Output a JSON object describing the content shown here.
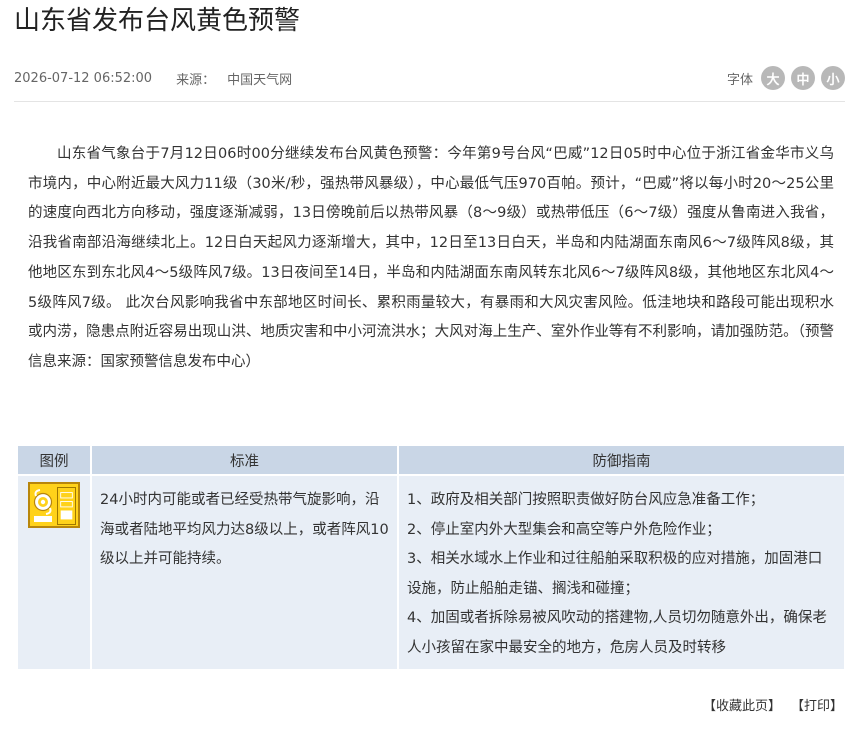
{
  "article": {
    "title": "山东省发布台风黄色预警",
    "date": "2026-07-12 06:52:00",
    "source_label": "来源：",
    "source": "中国天气网",
    "body": "山东省气象台于7月12日06时00分继续发布台风黄色预警：今年第9号台风“巴威”12日05时中心位于浙江省金华市义乌市境内，中心附近最大风力11级（30米/秒，强热带风暴级），中心最低气压970百帕。预计，“巴威”将以每小时20～25公里的速度向西北方向移动，强度逐渐减弱，13日傍晚前后以热带风暴（8～9级）或热带低压（6～7级）强度从鲁南进入我省，沿我省南部沿海继续北上。12日白天起风力逐渐增大，其中，12日至13日白天，半岛和内陆湖面东南风6～7级阵风8级，其他地区东到东北风4～5级阵风7级。13日夜间至14日，半岛和内陆湖面东南风转东北风6～7级阵风8级，其他地区东北风4～5级阵风7级。 此次台风影响我省中东部地区时间长、累积雨量较大，有暴雨和大风灾害风险。低洼地块和路段可能出现积水或内涝，隐患点附近容易出现山洪、地质灾害和中小河流洪水；大风对海上生产、室外作业等有不利影响，请加强防范。（预警信息来源：国家预警信息发布中心）"
  },
  "font_size": {
    "label": "字体",
    "large": "大",
    "medium": "中",
    "small": "小"
  },
  "table": {
    "headers": [
      "图例",
      "标准",
      "防御指南"
    ],
    "icon": "typhoon-yellow-warning-icon",
    "standard": "24小时内可能或者已经受热带气旋影响，沿海或者陆地平均风力达8级以上，或者阵风10级以上并可能持续。",
    "guides": [
      "1、政府及相关部门按照职责做好防台风应急准备工作；",
      "2、停止室内外大型集会和高空等户外危险作业；",
      "3、相关水域水上作业和过往船舶采取积极的应对措施，加固港口设施，防止船舶走锚、搁浅和碰撞；",
      "4、加固或者拆除易被风吹动的搭建物,人员切勿随意外出，确保老人小孩留在家中最安全的地方，危房人员及时转移"
    ]
  },
  "footer": {
    "favorite": "【收藏此页】",
    "print": "【打印】"
  },
  "colors": {
    "header_bg": "#c9d6e6",
    "cell_bg": "#e8eef6",
    "warning_yellow": "#ffd21a",
    "font_button": "#b8b8b8"
  }
}
